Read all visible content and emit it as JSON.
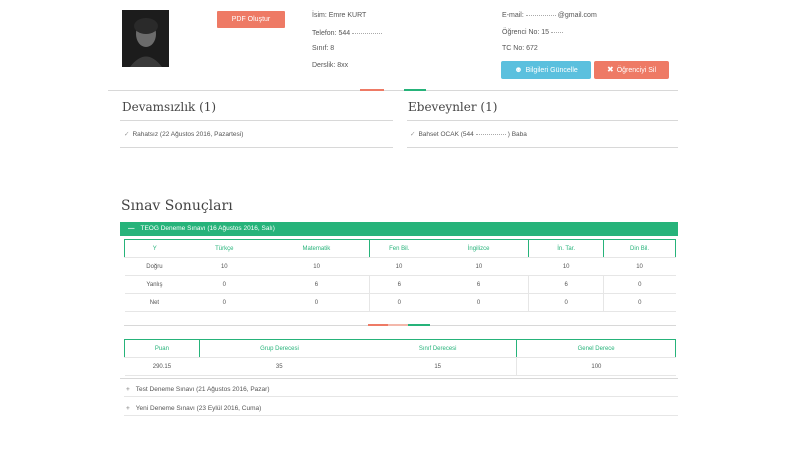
{
  "profile": {
    "pdf_button": "PDF Oluştur",
    "name_label": "İsim: Emre KURT",
    "phone_label": "Telefon: 544",
    "class_label": "Sınıf: 8",
    "section_label": "Derslik: 8xx",
    "email_label": "E-mail:",
    "email_suffix": "@gmail.com",
    "student_no_label": "Öğrenci No: 15",
    "tc_label": "TC No: 672",
    "update_button": "Bilgileri Güncelle",
    "delete_button": "Öğrenciyi Sil"
  },
  "attendance": {
    "title": "Devamsızlık (1)",
    "items": [
      {
        "text": "Rahatsız (22 Ağustos 2016, Pazartesi)"
      }
    ]
  },
  "parents": {
    "title": "Ebeveynler (1)",
    "items": [
      {
        "text": "Bahset OCAK (544",
        "suffix": ") Baba"
      }
    ]
  },
  "exam_results": {
    "title": "Sınav Sonuçları",
    "open_exam": "TEOG Deneme Sınavı (16 Ağustos 2016, Salı)",
    "subject_table": {
      "headers": [
        "Y",
        "Türkçe",
        "Matematik",
        "Fen Bil.",
        "İngilizce",
        "İn. Tar.",
        "Din Bil."
      ],
      "rows": [
        [
          "Doğru",
          "10",
          "10",
          "10",
          "10",
          "10",
          "10"
        ],
        [
          "Yanlış",
          "0",
          "6",
          "6",
          "6",
          "6",
          "0"
        ],
        [
          "Net",
          "0",
          "0",
          "0",
          "0",
          "0",
          "0"
        ]
      ]
    },
    "score_table": {
      "headers": [
        "Puan",
        "Grup Derecesi",
        "Sınıf Derecesi",
        "Genel Derece"
      ],
      "row": [
        "290.15",
        "35",
        "15",
        "100"
      ]
    },
    "collapsed_exams": [
      "Test Deneme Sınavı (21 Ağustos 2016, Pazar)",
      "Yeni Deneme Sınavı (23 Eylül 2016, Cuma)"
    ]
  },
  "colors": {
    "green": "#26b37a",
    "orange": "#ee7a65",
    "blue": "#5bc0de"
  },
  "icons": {
    "update": "user-icon",
    "delete": "close-icon",
    "expand": "minus-icon",
    "collapse": "plus-icon",
    "check": "check-icon"
  }
}
